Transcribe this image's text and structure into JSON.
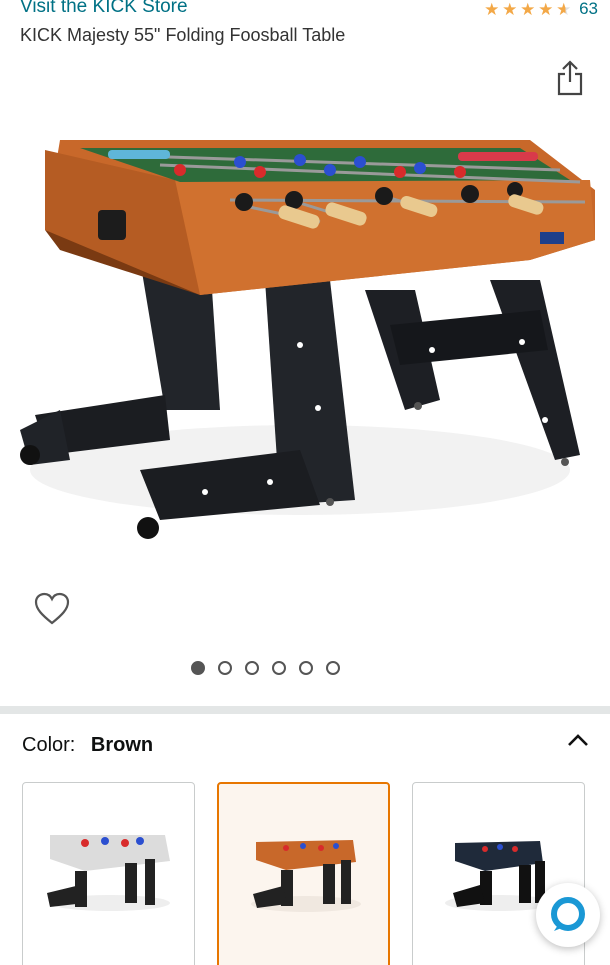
{
  "store": {
    "link_text": "Visit the KICK Store"
  },
  "rating": {
    "stars": 4.5,
    "count": "63",
    "star_color": "#f3a847"
  },
  "product": {
    "title": "KICK Majesty 55\" Folding Foosball Table"
  },
  "gallery": {
    "image_count": 6,
    "active_index": 0
  },
  "color": {
    "label": "Color:",
    "value": "Brown"
  },
  "swatches": [
    {
      "name": "White",
      "selected": false
    },
    {
      "name": "Brown",
      "selected": true
    },
    {
      "name": "Black",
      "selected": false
    }
  ],
  "icons": {
    "share": "share-icon",
    "heart": "heart-icon",
    "collapse": "chevron-up-icon",
    "chat": "chat-icon"
  },
  "colors": {
    "link": "#007185",
    "accent": "#e77600",
    "chat": "#1a98d5"
  }
}
